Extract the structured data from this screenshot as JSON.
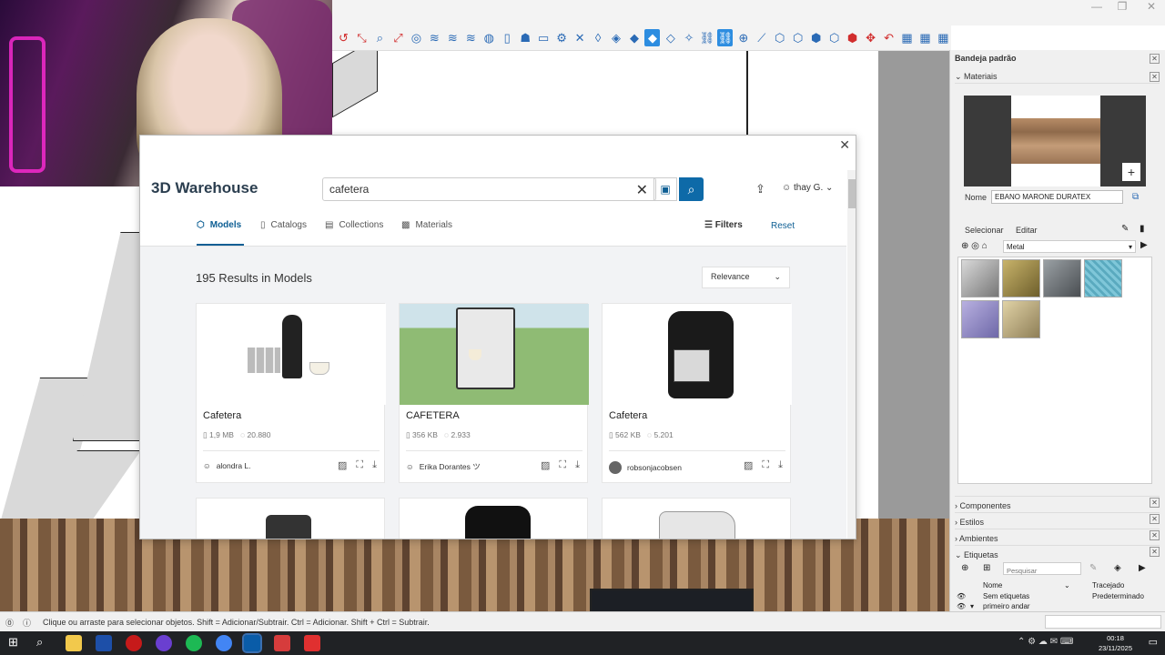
{
  "status_bar": {
    "hint": "Clique ou arraste para selecionar objetos. Shift = Adicionar/Subtrair. Ctrl = Adicionar. Shift + Ctrl = Subtrair."
  },
  "taskbar": {
    "time": "00:18",
    "date": "23/11/2025"
  },
  "warehouse": {
    "brand": "3D Warehouse",
    "search_value": "cafetera",
    "user": "thay G.",
    "tabs": [
      {
        "label": "Models"
      },
      {
        "label": "Catalogs"
      },
      {
        "label": "Collections"
      },
      {
        "label": "Materials"
      }
    ],
    "filters_label": "Filters",
    "reset_label": "Reset",
    "results_count": "195 Results in Models",
    "sort_label": "Relevance",
    "cards": [
      {
        "title": "Cafetera",
        "size": "1,9 MB",
        "downloads": "20.880",
        "author": "alondra L."
      },
      {
        "title": "CAFETERA",
        "size": "356 KB",
        "downloads": "2.933",
        "author": "Erika Dorantes ツ"
      },
      {
        "title": "Cafetera",
        "size": "562 KB",
        "downloads": "5.201",
        "author": "robsonjacobsen"
      }
    ]
  },
  "tray": {
    "title": "Bandeja padrão",
    "materials_header": "Materiais",
    "name_label": "Nome",
    "material_name": "EBANO MARONE DURATEX",
    "select_tab": "Selecionar",
    "edit_tab": "Editar",
    "library": "Metal",
    "sections": [
      {
        "label": "Componentes"
      },
      {
        "label": "Estilos"
      },
      {
        "label": "Ambientes"
      },
      {
        "label": "Etiquetas"
      }
    ],
    "tags_search_placeholder": "Pesquisar",
    "tags_cols": {
      "name": "Nome",
      "dashed": "Tracejado"
    },
    "tags_rows": [
      {
        "name": "Sem etiquetas",
        "dashed": "Predeterminado"
      },
      {
        "name": "primeiro andar",
        "dashed": ""
      }
    ]
  },
  "colors": {
    "accent": "#0e6aa8",
    "toolbar_active": "#2d8de0"
  }
}
